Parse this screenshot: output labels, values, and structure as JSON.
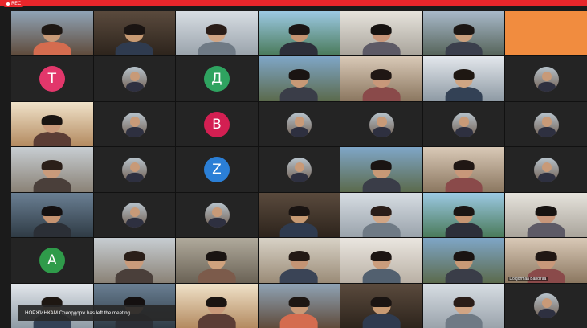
{
  "recording": {
    "label": "REC"
  },
  "notification": {
    "message": "НОРЖИНКАМ Сонордорж has left the meeting"
  },
  "colors": {
    "accent_red": "#e8262b",
    "tile_bg": "#242424"
  },
  "tiles": [
    {
      "kind": "video"
    },
    {
      "kind": "video"
    },
    {
      "kind": "video"
    },
    {
      "kind": "video"
    },
    {
      "kind": "video"
    },
    {
      "kind": "video"
    },
    {
      "kind": "solid",
      "color": "#f18c3f"
    },
    {
      "kind": "letter",
      "letter": "T",
      "color": "#e2376b"
    },
    {
      "kind": "photo"
    },
    {
      "kind": "letter",
      "letter": "Д",
      "color": "#2fa360"
    },
    {
      "kind": "video"
    },
    {
      "kind": "video"
    },
    {
      "kind": "video"
    },
    {
      "kind": "photo"
    },
    {
      "kind": "video"
    },
    {
      "kind": "photo"
    },
    {
      "kind": "letter",
      "letter": "B",
      "color": "#d31f52"
    },
    {
      "kind": "photo"
    },
    {
      "kind": "photo"
    },
    {
      "kind": "photo"
    },
    {
      "kind": "photo"
    },
    {
      "kind": "video"
    },
    {
      "kind": "photo"
    },
    {
      "kind": "letter",
      "letter": "Z",
      "color": "#2b7fd6"
    },
    {
      "kind": "photo"
    },
    {
      "kind": "video"
    },
    {
      "kind": "video"
    },
    {
      "kind": "photo"
    },
    {
      "kind": "video"
    },
    {
      "kind": "photo"
    },
    {
      "kind": "photo"
    },
    {
      "kind": "video"
    },
    {
      "kind": "video"
    },
    {
      "kind": "video"
    },
    {
      "kind": "video"
    },
    {
      "kind": "letter",
      "letter": "A",
      "color": "#2f9b4a"
    },
    {
      "kind": "video"
    },
    {
      "kind": "video"
    },
    {
      "kind": "video"
    },
    {
      "kind": "video"
    },
    {
      "kind": "video"
    },
    {
      "kind": "video",
      "label": "Dolgormaa Bandiraa"
    },
    {
      "kind": "video"
    },
    {
      "kind": "video"
    },
    {
      "kind": "video"
    },
    {
      "kind": "video"
    },
    {
      "kind": "video"
    },
    {
      "kind": "video"
    },
    {
      "kind": "photo"
    }
  ]
}
